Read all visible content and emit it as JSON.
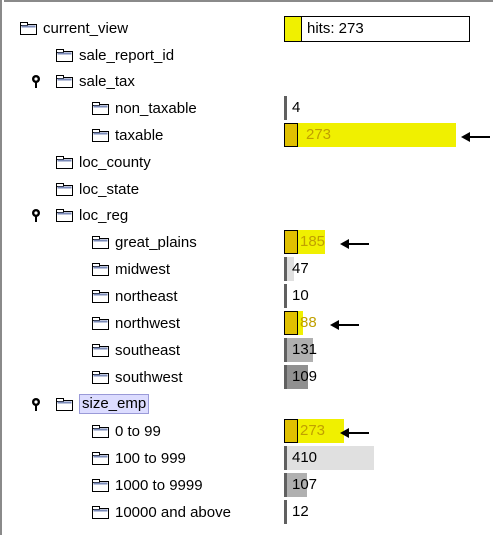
{
  "tree": {
    "nodes": [
      {
        "label": "current_view",
        "icon": "folder-icon"
      },
      {
        "label": "sale_report_id",
        "icon": "folder-icon"
      },
      {
        "label": "sale_tax",
        "icon": "folder-icon",
        "pinned": true
      },
      {
        "label": "non_taxable",
        "icon": "folder-icon"
      },
      {
        "label": "taxable",
        "icon": "folder-icon"
      },
      {
        "label": "loc_county",
        "icon": "folder-icon"
      },
      {
        "label": "loc_state",
        "icon": "folder-icon"
      },
      {
        "label": "loc_reg",
        "icon": "folder-icon",
        "pinned": true
      },
      {
        "label": "great_plains",
        "icon": "folder-icon"
      },
      {
        "label": "midwest",
        "icon": "folder-icon"
      },
      {
        "label": "northeast",
        "icon": "folder-icon"
      },
      {
        "label": "northwest",
        "icon": "folder-icon"
      },
      {
        "label": "southeast",
        "icon": "folder-icon"
      },
      {
        "label": "southwest",
        "icon": "folder-icon"
      },
      {
        "label": "size_emp",
        "icon": "folder-icon",
        "pinned": true,
        "selected": true
      },
      {
        "label": "0 to 99",
        "icon": "folder-icon"
      },
      {
        "label": "100 to 999",
        "icon": "folder-icon"
      },
      {
        "label": "1000 to 9999",
        "icon": "folder-icon"
      },
      {
        "label": "10000 and above",
        "icon": "folder-icon"
      }
    ]
  },
  "hits": {
    "text": "hits: 273",
    "value": 273
  },
  "bars": [
    {
      "node": "non_taxable",
      "count": "4",
      "value": 4,
      "highlight": false,
      "fraction": 0.0
    },
    {
      "node": "taxable",
      "count": "273",
      "value": 273,
      "highlight": true,
      "fraction": 1.0,
      "arrow": true
    },
    {
      "node": "great_plains",
      "count": "185",
      "value": 185,
      "highlight": true,
      "fraction": 1.0,
      "arrow": true
    },
    {
      "node": "midwest",
      "count": "47",
      "value": 47,
      "highlight": false,
      "fraction": 0.0
    },
    {
      "node": "northeast",
      "count": "10",
      "value": 10,
      "highlight": false,
      "fraction": 0.0
    },
    {
      "node": "northwest",
      "count": "88",
      "value": 88,
      "highlight": true,
      "fraction": 1.0,
      "arrow": true
    },
    {
      "node": "southeast",
      "count": "131",
      "value": 131,
      "highlight": false,
      "fraction": 0.0
    },
    {
      "node": "southwest",
      "count": "109",
      "value": 109,
      "highlight": false,
      "fraction": 0.0
    },
    {
      "node": "0 to 99",
      "count": "273",
      "value": 273,
      "highlight": true,
      "fraction": 1.0,
      "arrow": true
    },
    {
      "node": "100 to 999",
      "count": "410",
      "value": 410,
      "highlight": false,
      "fraction": 0.0
    },
    {
      "node": "1000 to 9999",
      "count": "107",
      "value": 107,
      "highlight": false,
      "fraction": 0.0
    },
    {
      "node": "10000 and above",
      "count": "12",
      "value": 12,
      "highlight": false,
      "fraction": 0.0
    }
  ],
  "colors": {
    "highlight": "#f0f000",
    "highlight_text": "#c0a000",
    "bar_gray_light": "#e0e0e0",
    "bar_gray_mid": "#b0b0b0",
    "bar_gray_dark": "#909090",
    "selection": "#dcdcff"
  }
}
